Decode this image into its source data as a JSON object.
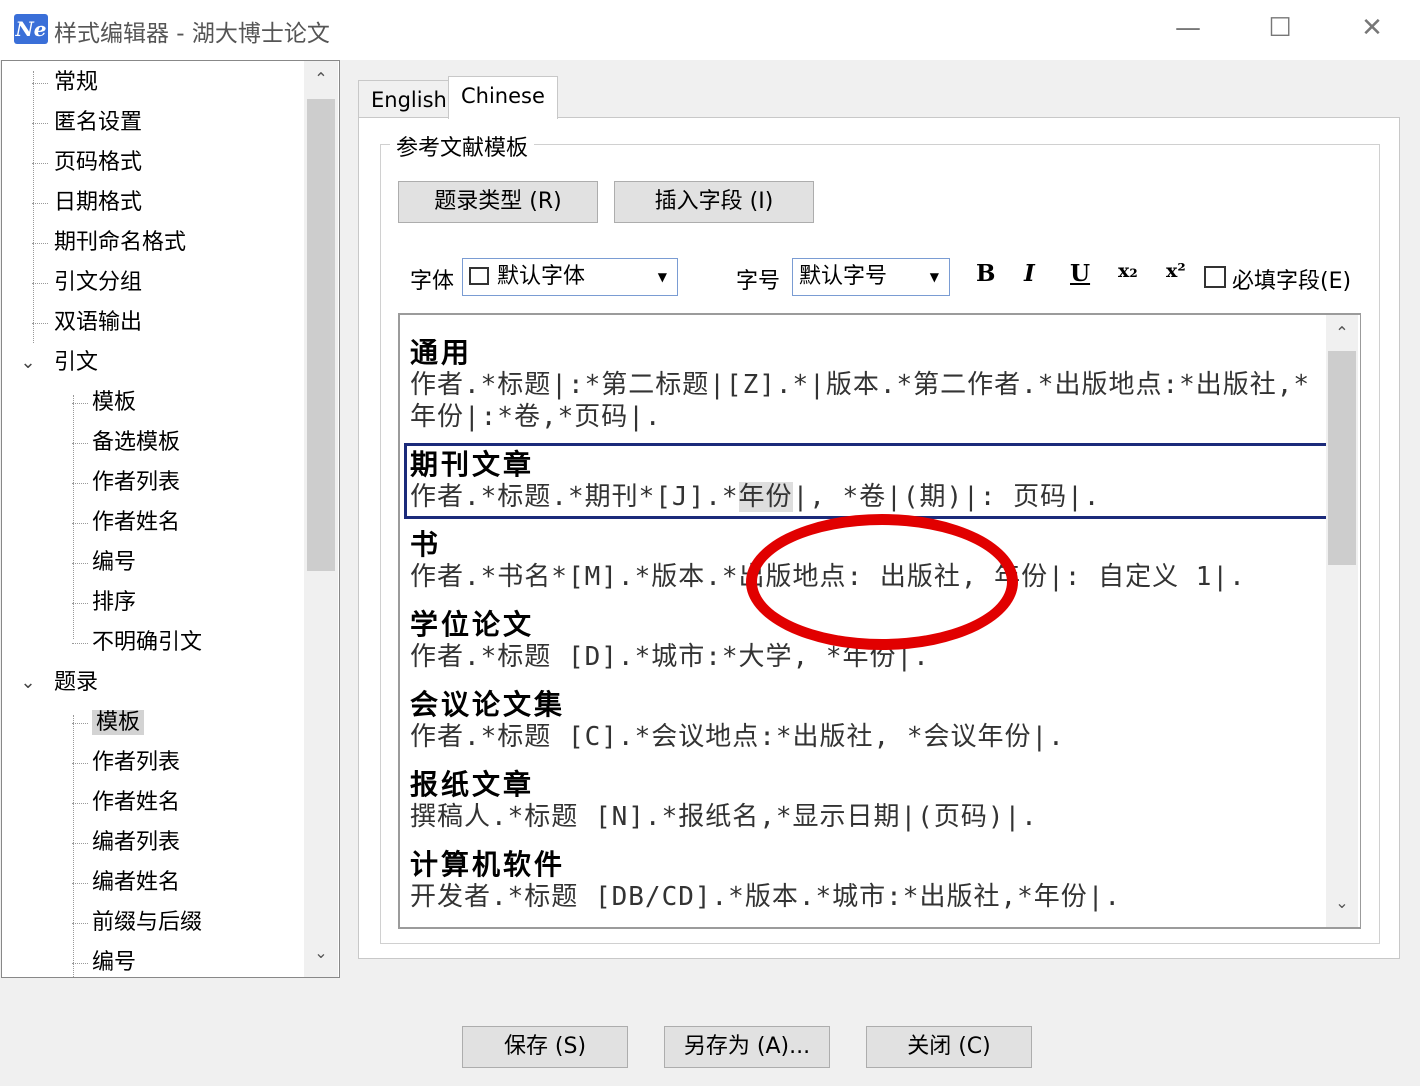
{
  "window": {
    "logo": "Ne",
    "title": "样式编辑器 - 湖大博士论文",
    "controls": {
      "minimize": "—",
      "maximize": "☐",
      "close": "✕"
    }
  },
  "tree": {
    "items": [
      {
        "label": "常规"
      },
      {
        "label": "匿名设置"
      },
      {
        "label": "页码格式"
      },
      {
        "label": "日期格式"
      },
      {
        "label": "期刊命名格式"
      },
      {
        "label": "引文分组"
      },
      {
        "label": "双语输出"
      },
      {
        "label": "引文",
        "expanded": true
      },
      {
        "label": "模板"
      },
      {
        "label": "备选模板"
      },
      {
        "label": "作者列表"
      },
      {
        "label": "作者姓名"
      },
      {
        "label": "编号"
      },
      {
        "label": "排序"
      },
      {
        "label": "不明确引文"
      },
      {
        "label": "题录",
        "expanded": true
      },
      {
        "label": "模板",
        "selected": true
      },
      {
        "label": "作者列表"
      },
      {
        "label": "作者姓名"
      },
      {
        "label": "编者列表"
      },
      {
        "label": "编者姓名"
      },
      {
        "label": "前缀与后缀"
      },
      {
        "label": "编号"
      }
    ]
  },
  "tabs": [
    {
      "label": "English",
      "active": false
    },
    {
      "label": "Chinese",
      "active": true
    }
  ],
  "group": {
    "legend": "参考文献模板",
    "ref_type_button": "题录类型 (R)",
    "insert_field_button": "插入字段 (I)"
  },
  "format": {
    "font_label": "字体",
    "font_value": "默认字体",
    "size_label": "字号",
    "size_value": "默认字号",
    "bold": "B",
    "italic": "I",
    "underline": "U",
    "subscript": "x₂",
    "superscript": "x²",
    "required_label": "必填字段(E)"
  },
  "templates": [
    {
      "name": "通用",
      "text": "作者.*标题|:*第二标题|[Z].*|版本.*第二作者.*出版地点:*出版社,*年份|:*卷,*页码|."
    },
    {
      "name": "期刊文章",
      "text_pre": "作者.*标题.*期刊*[J].*",
      "text_hl": "年份",
      "text_post": "|, *卷|(期)|: 页码|."
    },
    {
      "name": "书",
      "text": "作者.*书名*[M].*版本.*出版地点: 出版社, 年份|: 自定义 1|."
    },
    {
      "name": "学位论文",
      "text": "作者.*标题 [D].*城市:*大学, *年份|."
    },
    {
      "name": "会议论文集",
      "text": "作者.*标题 [C].*会议地点:*出版社, *会议年份|."
    },
    {
      "name": "报纸文章",
      "text": "撰稿人.*标题 [N].*报纸名,*显示日期|(页码)|."
    },
    {
      "name": "计算机软件",
      "text": "开发者.*标题 [DB/CD].*版本.*城市:*出版社,*年份|."
    }
  ],
  "buttons": {
    "save": "保存 (S)",
    "save_as": "另存为 (A)...",
    "close": "关闭 (C)"
  },
  "colors": {
    "selection_outline": "#1b2a7a",
    "annotation_circle": "#e10000",
    "logo_bg": "#3a6fd8"
  }
}
